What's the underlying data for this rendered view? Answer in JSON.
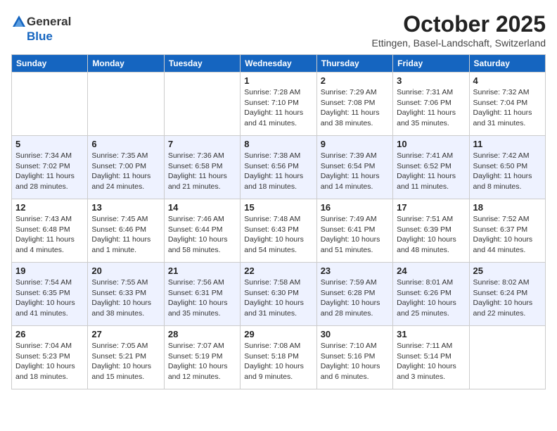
{
  "header": {
    "logo_general": "General",
    "logo_blue": "Blue",
    "month": "October 2025",
    "location": "Ettingen, Basel-Landschaft, Switzerland"
  },
  "days_of_week": [
    "Sunday",
    "Monday",
    "Tuesday",
    "Wednesday",
    "Thursday",
    "Friday",
    "Saturday"
  ],
  "weeks": [
    [
      {
        "day": "",
        "info": ""
      },
      {
        "day": "",
        "info": ""
      },
      {
        "day": "",
        "info": ""
      },
      {
        "day": "1",
        "info": "Sunrise: 7:28 AM\nSunset: 7:10 PM\nDaylight: 11 hours and 41 minutes."
      },
      {
        "day": "2",
        "info": "Sunrise: 7:29 AM\nSunset: 7:08 PM\nDaylight: 11 hours and 38 minutes."
      },
      {
        "day": "3",
        "info": "Sunrise: 7:31 AM\nSunset: 7:06 PM\nDaylight: 11 hours and 35 minutes."
      },
      {
        "day": "4",
        "info": "Sunrise: 7:32 AM\nSunset: 7:04 PM\nDaylight: 11 hours and 31 minutes."
      }
    ],
    [
      {
        "day": "5",
        "info": "Sunrise: 7:34 AM\nSunset: 7:02 PM\nDaylight: 11 hours and 28 minutes."
      },
      {
        "day": "6",
        "info": "Sunrise: 7:35 AM\nSunset: 7:00 PM\nDaylight: 11 hours and 24 minutes."
      },
      {
        "day": "7",
        "info": "Sunrise: 7:36 AM\nSunset: 6:58 PM\nDaylight: 11 hours and 21 minutes."
      },
      {
        "day": "8",
        "info": "Sunrise: 7:38 AM\nSunset: 6:56 PM\nDaylight: 11 hours and 18 minutes."
      },
      {
        "day": "9",
        "info": "Sunrise: 7:39 AM\nSunset: 6:54 PM\nDaylight: 11 hours and 14 minutes."
      },
      {
        "day": "10",
        "info": "Sunrise: 7:41 AM\nSunset: 6:52 PM\nDaylight: 11 hours and 11 minutes."
      },
      {
        "day": "11",
        "info": "Sunrise: 7:42 AM\nSunset: 6:50 PM\nDaylight: 11 hours and 8 minutes."
      }
    ],
    [
      {
        "day": "12",
        "info": "Sunrise: 7:43 AM\nSunset: 6:48 PM\nDaylight: 11 hours and 4 minutes."
      },
      {
        "day": "13",
        "info": "Sunrise: 7:45 AM\nSunset: 6:46 PM\nDaylight: 11 hours and 1 minute."
      },
      {
        "day": "14",
        "info": "Sunrise: 7:46 AM\nSunset: 6:44 PM\nDaylight: 10 hours and 58 minutes."
      },
      {
        "day": "15",
        "info": "Sunrise: 7:48 AM\nSunset: 6:43 PM\nDaylight: 10 hours and 54 minutes."
      },
      {
        "day": "16",
        "info": "Sunrise: 7:49 AM\nSunset: 6:41 PM\nDaylight: 10 hours and 51 minutes."
      },
      {
        "day": "17",
        "info": "Sunrise: 7:51 AM\nSunset: 6:39 PM\nDaylight: 10 hours and 48 minutes."
      },
      {
        "day": "18",
        "info": "Sunrise: 7:52 AM\nSunset: 6:37 PM\nDaylight: 10 hours and 44 minutes."
      }
    ],
    [
      {
        "day": "19",
        "info": "Sunrise: 7:54 AM\nSunset: 6:35 PM\nDaylight: 10 hours and 41 minutes."
      },
      {
        "day": "20",
        "info": "Sunrise: 7:55 AM\nSunset: 6:33 PM\nDaylight: 10 hours and 38 minutes."
      },
      {
        "day": "21",
        "info": "Sunrise: 7:56 AM\nSunset: 6:31 PM\nDaylight: 10 hours and 35 minutes."
      },
      {
        "day": "22",
        "info": "Sunrise: 7:58 AM\nSunset: 6:30 PM\nDaylight: 10 hours and 31 minutes."
      },
      {
        "day": "23",
        "info": "Sunrise: 7:59 AM\nSunset: 6:28 PM\nDaylight: 10 hours and 28 minutes."
      },
      {
        "day": "24",
        "info": "Sunrise: 8:01 AM\nSunset: 6:26 PM\nDaylight: 10 hours and 25 minutes."
      },
      {
        "day": "25",
        "info": "Sunrise: 8:02 AM\nSunset: 6:24 PM\nDaylight: 10 hours and 22 minutes."
      }
    ],
    [
      {
        "day": "26",
        "info": "Sunrise: 7:04 AM\nSunset: 5:23 PM\nDaylight: 10 hours and 18 minutes."
      },
      {
        "day": "27",
        "info": "Sunrise: 7:05 AM\nSunset: 5:21 PM\nDaylight: 10 hours and 15 minutes."
      },
      {
        "day": "28",
        "info": "Sunrise: 7:07 AM\nSunset: 5:19 PM\nDaylight: 10 hours and 12 minutes."
      },
      {
        "day": "29",
        "info": "Sunrise: 7:08 AM\nSunset: 5:18 PM\nDaylight: 10 hours and 9 minutes."
      },
      {
        "day": "30",
        "info": "Sunrise: 7:10 AM\nSunset: 5:16 PM\nDaylight: 10 hours and 6 minutes."
      },
      {
        "day": "31",
        "info": "Sunrise: 7:11 AM\nSunset: 5:14 PM\nDaylight: 10 hours and 3 minutes."
      },
      {
        "day": "",
        "info": ""
      }
    ]
  ]
}
